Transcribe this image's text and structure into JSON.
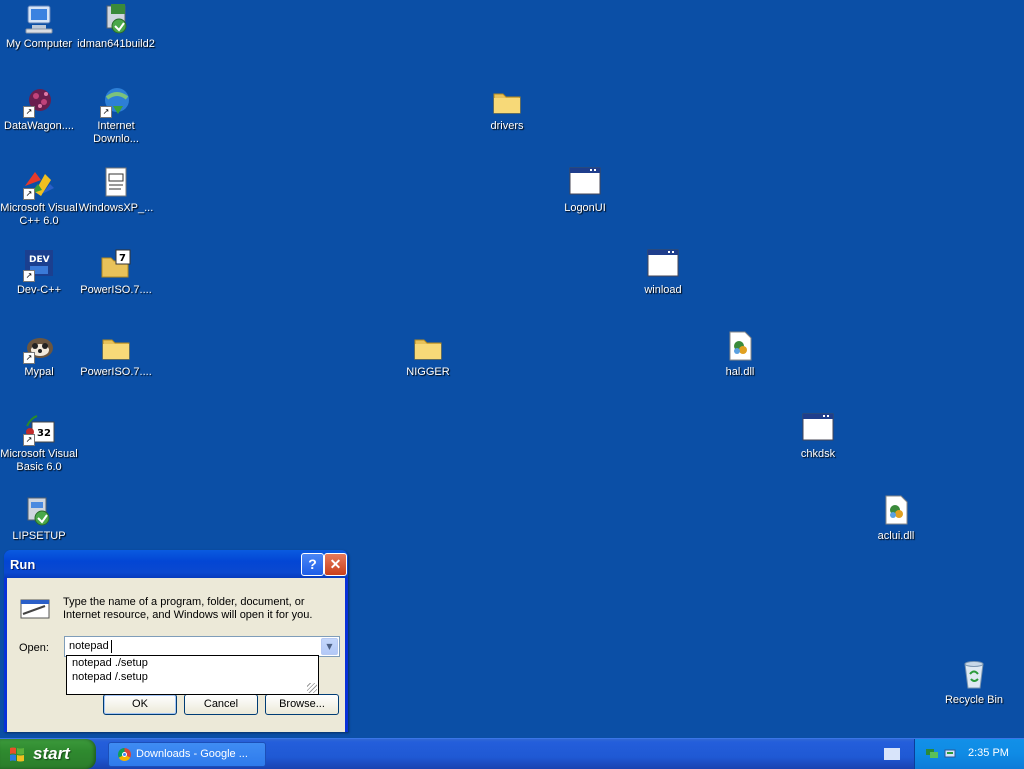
{
  "desktop": {
    "icons": [
      {
        "label": "My Computer",
        "icon": "my-computer-icon"
      },
      {
        "label": "idman641build2",
        "icon": "installer-icon"
      },
      {
        "label": "DataWagon....",
        "icon": "datawagon-icon"
      },
      {
        "label": "Internet Downlo...",
        "icon": "internet-download-manager-icon"
      },
      {
        "label": "drivers",
        "icon": "folder-icon"
      },
      {
        "label": "Microsoft Visual C++ 6.0",
        "icon": "visual-cpp-icon"
      },
      {
        "label": "WindowsXP_...",
        "icon": "document-icon"
      },
      {
        "label": "LogonUI",
        "icon": "application-window-icon"
      },
      {
        "label": "Dev-C++",
        "icon": "dev-cpp-icon"
      },
      {
        "label": "PowerISO.7....",
        "icon": "winrar-archive-icon"
      },
      {
        "label": "winload",
        "icon": "application-window-icon"
      },
      {
        "label": "Mypal",
        "icon": "mypal-browser-icon"
      },
      {
        "label": "PowerISO.7....",
        "icon": "folder-icon"
      },
      {
        "label": "NIGGER",
        "icon": "folder-icon"
      },
      {
        "label": "hal.dll",
        "icon": "dll-file-icon"
      },
      {
        "label": "Microsoft Visual Basic 6.0",
        "icon": "visual-basic-icon"
      },
      {
        "label": "chkdsk",
        "icon": "application-window-icon"
      },
      {
        "label": "LIPSETUP",
        "icon": "setup-icon"
      },
      {
        "label": "aclui.dll",
        "icon": "dll-file-icon"
      },
      {
        "label": "Recycle Bin",
        "icon": "recycle-bin-icon"
      }
    ]
  },
  "run_dialog": {
    "title": "Run",
    "help_glyph": "?",
    "close_glyph": "✕",
    "description": "Type the name of a program, folder, document, or Internet resource, and Windows will open it for you.",
    "open_label": "Open:",
    "open_value": "notepad",
    "autocomplete": [
      "notepad ./setup",
      "notepad /.setup"
    ],
    "ok_label": "OK",
    "cancel_label": "Cancel",
    "browse_label": "Browse..."
  },
  "taskbar": {
    "start_label": "start",
    "tasks": [
      {
        "label": "Downloads - Google ...",
        "icon": "chrome-icon"
      }
    ],
    "clock": "2:35 PM"
  }
}
